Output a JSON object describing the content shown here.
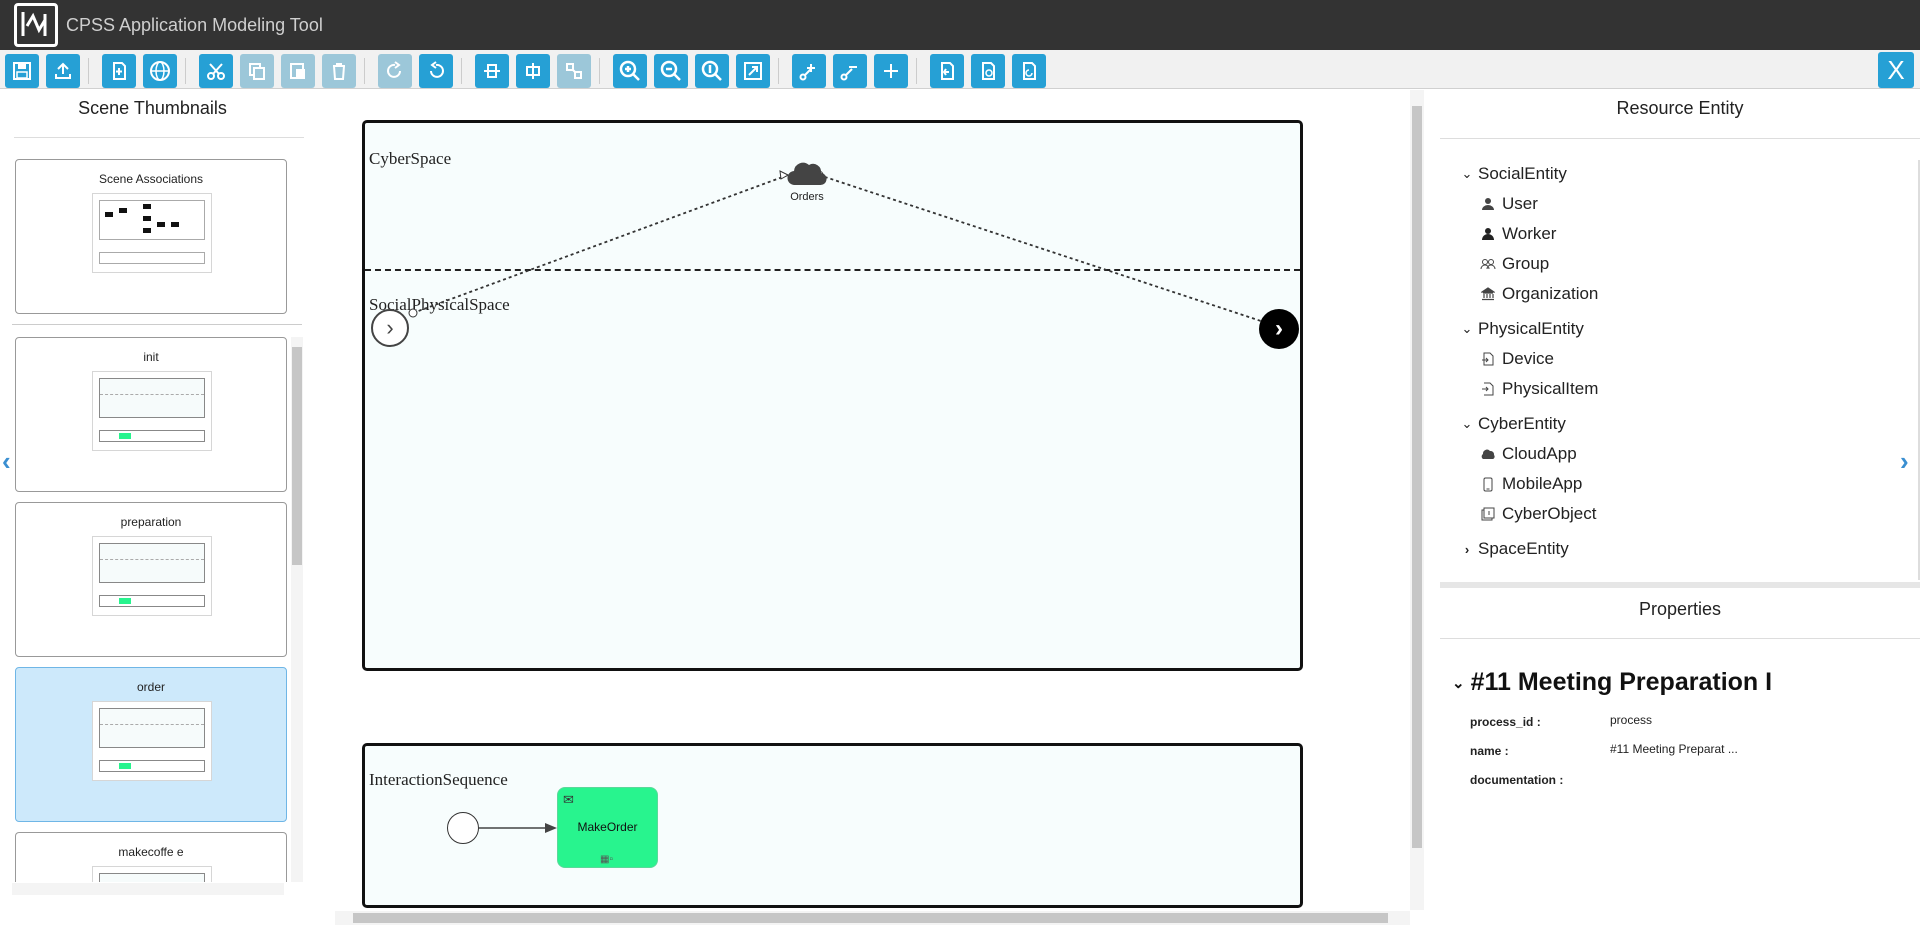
{
  "app": {
    "title": "CPSS Application Modeling Tool"
  },
  "toolbar": {
    "close_label": "X"
  },
  "left_panel": {
    "title": "Scene Thumbnails",
    "thumbnails": [
      {
        "label": "Scene Associations",
        "selected": false
      },
      {
        "label": "init",
        "selected": false
      },
      {
        "label": "preparation",
        "selected": false
      },
      {
        "label": "order",
        "selected": true
      },
      {
        "label": "makecoffe e",
        "selected": false
      }
    ]
  },
  "diagram": {
    "lanes": {
      "cyber": "CyberSpace",
      "social_physical": "SocialPhysicalSpace",
      "interaction": "InteractionSequence"
    },
    "cloud_node": "Orders",
    "task": "MakeOrder"
  },
  "right_panel": {
    "resource_title": "Resource Entity",
    "tree": [
      {
        "label": "SocialEntity",
        "icon": "chevron-down-icon",
        "children": [
          {
            "label": "User",
            "icon": "user-icon"
          },
          {
            "label": "Worker",
            "icon": "worker-icon"
          },
          {
            "label": "Group",
            "icon": "group-icon"
          },
          {
            "label": "Organization",
            "icon": "organization-icon"
          }
        ]
      },
      {
        "label": "PhysicalEntity",
        "icon": "chevron-down-icon",
        "children": [
          {
            "label": "Device",
            "icon": "device-icon"
          },
          {
            "label": "PhysicalItem",
            "icon": "physical-item-icon"
          }
        ]
      },
      {
        "label": "CyberEntity",
        "icon": "chevron-down-icon",
        "children": [
          {
            "label": "CloudApp",
            "icon": "cloud-icon"
          },
          {
            "label": "MobileApp",
            "icon": "mobile-icon"
          },
          {
            "label": "CyberObject",
            "icon": "cyber-object-icon"
          }
        ]
      },
      {
        "label": "SpaceEntity",
        "icon": "chevron-right-icon",
        "children": []
      }
    ],
    "properties_title": "Properties",
    "properties_heading": "#11 Meeting Preparation I",
    "properties": [
      {
        "key": "process_id :",
        "value": "process"
      },
      {
        "key": "name :",
        "value": "#11 Meeting Preparat ..."
      },
      {
        "key": "documentation :",
        "value": ""
      }
    ]
  },
  "colors": {
    "accent": "#26a0d5",
    "task_fill": "#28f48e",
    "titlebar": "#333333"
  }
}
